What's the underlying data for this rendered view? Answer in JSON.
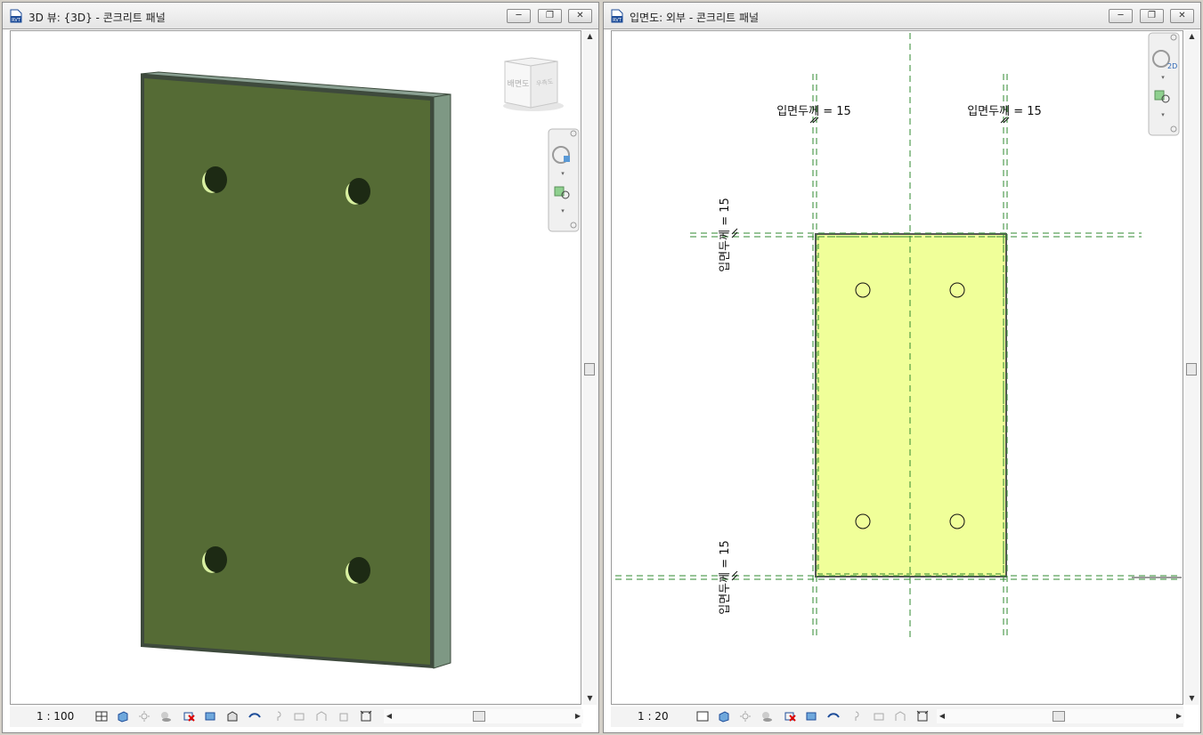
{
  "left_window": {
    "title": "3D 뷰: {3D} - 콘크리트 패널",
    "scale": "1 : 100",
    "viewcube_face_label": "배면도",
    "viewcube_side_label": "우측도",
    "title_icon_text": "RVT"
  },
  "right_window": {
    "title": "입면도: 외부 - 콘크리트 패널",
    "scale": "1 : 20",
    "title_icon_text": "RVT",
    "nav_bar_2d_label": "2D",
    "dimension_labels": {
      "top_left": "입면두께 = 15",
      "top_right": "입면두께 = 15",
      "left_upper": "입면두께 = 15",
      "left_lower": "입면두께 = 15"
    }
  },
  "window_controls": {
    "minimize": "─",
    "restore": "❐",
    "close": "✕"
  },
  "colors": {
    "panel_face": "#556b35",
    "panel_edge": "#7e9884",
    "elevation_fill": "#f0ff99",
    "ref_line": "#2f8a2f"
  },
  "icons": [
    "file-rvt-icon",
    "minimize-icon",
    "restore-icon",
    "close-icon",
    "viewcube-icon",
    "steering-wheel-icon",
    "zoom-region-icon",
    "visual-style-icon",
    "sun-path-icon",
    "shadows-icon",
    "crop-view-icon",
    "reveal-hidden-icon",
    "temporary-hide-icon",
    "scroll-arrow-icon"
  ]
}
